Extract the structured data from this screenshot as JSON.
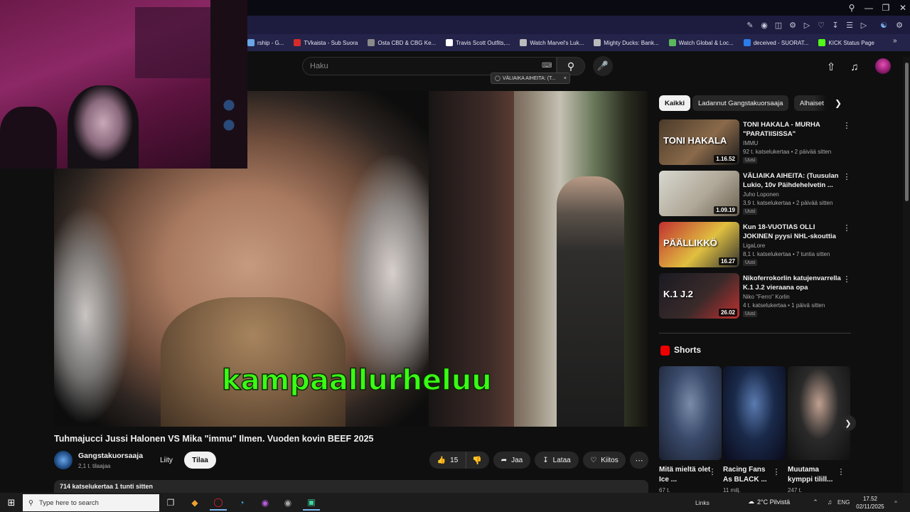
{
  "browser": {
    "bookmarks": [
      {
        "label": "rship - G...",
        "color": "#6aa6e8"
      },
      {
        "label": "TVkaista - Sub Suora",
        "color": "#d62b2b"
      },
      {
        "label": "Osta CBD & CBG Ke...",
        "color": "#8a8a8a"
      },
      {
        "label": "Travis Scott Outfits,...",
        "color": "#ffffff"
      },
      {
        "label": "Watch Marvel's Luk...",
        "color": "#bbbbbb"
      },
      {
        "label": "Mighty Ducks: Bank...",
        "color": "#bbbbbb"
      },
      {
        "label": "Watch Global & Loc...",
        "color": "#5cb85c"
      },
      {
        "label": "deceived - SUORAT...",
        "color": "#2b7de9"
      },
      {
        "label": "KICK Status Page",
        "color": "#53fc18"
      }
    ]
  },
  "header": {
    "search_placeholder": "Haku",
    "tooltip": "VÄLIAIKA AIHEITA: (T..."
  },
  "video": {
    "caption": "kampaallurheluu",
    "title": "Tuhmajucci Jussi Halonen VS Mika \"immu\" Ilmen. Vuoden kovin BEEF 2025",
    "channel": "Gangstakuorsaaja",
    "subscribers": "2,1 t. tilaajaa",
    "join_label": "Liity",
    "subscribe_label": "Tilaa",
    "likes": "15",
    "share_label": "Jaa",
    "download_label": "Lataa",
    "thanks_label": "Kiitos",
    "description_meta": "714 katselukertaa  1 tunti sitten"
  },
  "chips": [
    "Kaikki",
    "Ladannut Gangstakuorsaaja",
    "Alhaiset"
  ],
  "recommendations": [
    {
      "title": "TONI HAKALA - MURHA \"PARATIISISSA\"",
      "channel": "IMMU",
      "meta": "92 t. katselukertaa • 2 päivää sitten",
      "badge": "Uusi",
      "duration": "1.16.52",
      "thumb_text": "TONI HAKALA",
      "thumb_colors": [
        "#4a3a2a",
        "#8a6a4a",
        "#1a1a1a"
      ]
    },
    {
      "title": "VÄLIAIKA AIHEITA: (Tuusulan Lukio, 10v Päihdehelvetin ...",
      "channel": "Juho Loponen",
      "meta": "3,9 t. katselukertaa • 2 päivää sitten",
      "badge": "Uusi",
      "duration": "1.09.19",
      "thumb_text": "",
      "thumb_colors": [
        "#d8d8d0",
        "#b0a898",
        "#6a6050"
      ]
    },
    {
      "title": "Kun 18-VUOTIAS OLLI JOKINEN pyysi NHL-skouttia menemää...",
      "channel": "LigaLore",
      "meta": "8,1 t. katselukertaa • 7 tuntia sitten",
      "badge": "Uusi",
      "duration": "16.27",
      "thumb_text": "PÄÄLLIKKÖ",
      "thumb_colors": [
        "#c23030",
        "#e0c040",
        "#303030"
      ]
    },
    {
      "title": "Nikoferrokorlin katujenvarrella K.1 J.2 vieraana opa t@freeopa",
      "channel": "Niko \"Ferro\" Korlin",
      "meta": "4 t. katselukertaa • 1 päivä sitten",
      "badge": "Uusi",
      "duration": "26.02",
      "thumb_text": "K.1 J.2",
      "thumb_colors": [
        "#1a1a22",
        "#3a2a2a",
        "#c03030"
      ]
    }
  ],
  "shorts": {
    "heading": "Shorts",
    "items": [
      {
        "title": "Mitä mieltä olet Ice ...",
        "views": "67 t.",
        "colors": [
          "#3a4a6a",
          "#7a8aa8",
          "#1a2030"
        ]
      },
      {
        "title": "Racing Fans As BLACK ...",
        "views": "11 milj.",
        "colors": [
          "#1a2a4a",
          "#5a7ab0",
          "#0a0a1a"
        ]
      },
      {
        "title": "Muutama kymppi tilill...",
        "views": "247 t.",
        "colors": [
          "#2a2a2a",
          "#c0a090",
          "#101010"
        ]
      }
    ]
  },
  "taskbar": {
    "search_placeholder": "Type here to search",
    "links": "Links",
    "weather": "2°C  Pilvistä",
    "lang": "ENG",
    "time": "17.52",
    "date": "02/11/2025"
  }
}
